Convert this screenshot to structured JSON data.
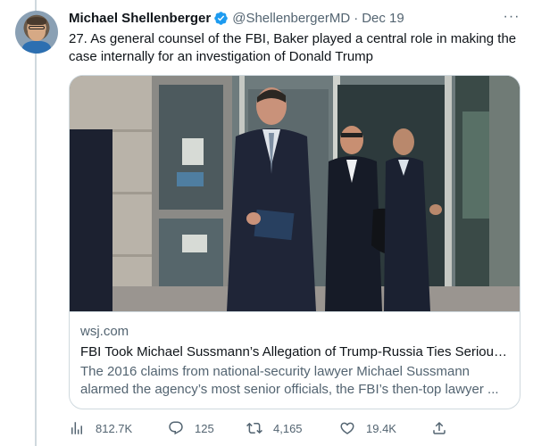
{
  "tweet": {
    "author_name": "Michael Shellenberger",
    "handle": "@ShellenbergerMD",
    "separator": "·",
    "date": "Dec 19",
    "text": "27. As general counsel of the FBI, Baker played a central role in making the case internally for an investigation of Donald Trump"
  },
  "card": {
    "domain": "wsj.com",
    "title": "FBI Took Michael Sussmann’s Allegation of Trump-Russia Ties Serious...",
    "description": "The 2016 claims from national-security lawyer Michael Sussmann alarmed the agency’s most senior officials, the FBI’s then-top lawyer ..."
  },
  "actions": {
    "views": "812.7K",
    "replies": "125",
    "retweets": "4,165",
    "likes": "19.4K"
  },
  "more_label": "···",
  "icons": [
    "avatar",
    "verified-badge-icon",
    "more-icon",
    "views-icon",
    "reply-icon",
    "retweet-icon",
    "like-icon",
    "share-icon"
  ],
  "colors": {
    "accent": "#1d9bf0",
    "muted": "#536471",
    "text": "#0f1419",
    "border": "#cfd9de"
  }
}
